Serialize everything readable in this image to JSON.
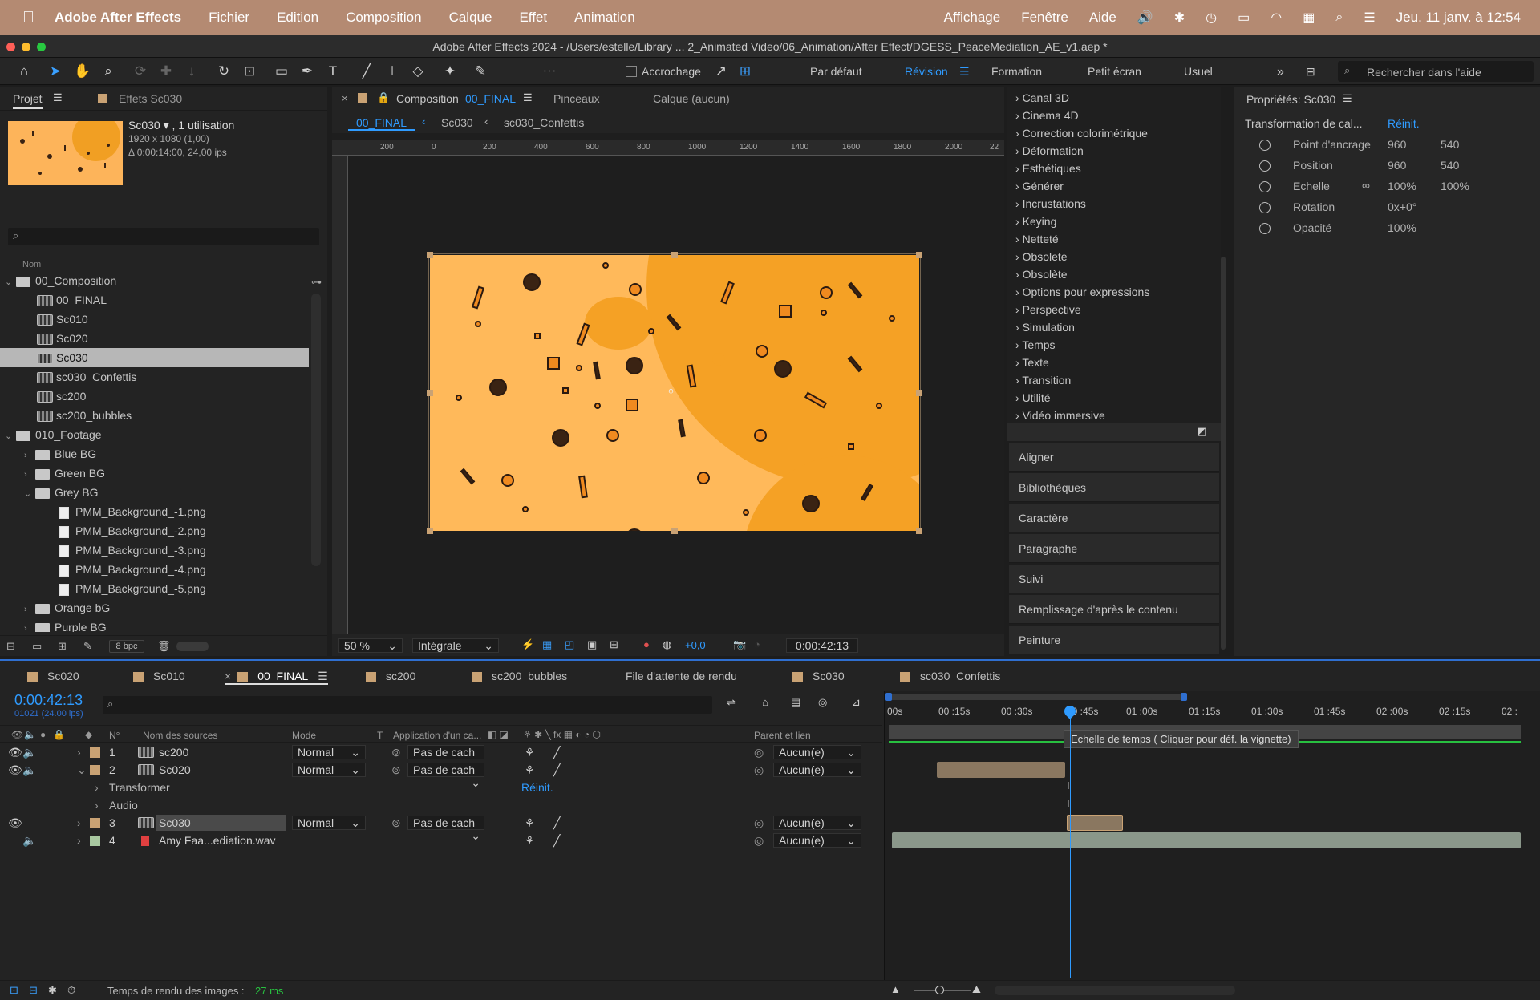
{
  "menubar": {
    "app_name": "Adobe After Effects",
    "items": [
      "Fichier",
      "Edition",
      "Composition",
      "Calque",
      "Effet",
      "Animation"
    ],
    "right_items": [
      "Affichage",
      "Fenêtre",
      "Aide"
    ],
    "clock": "Jeu. 11 janv. à 12:54"
  },
  "window": {
    "title": "Adobe After Effects 2024 - /Users/estelle/Library ... 2_Animated Video/06_Animation/After Effect/DGESS_PeaceMediation_AE_v1.aep *"
  },
  "toolbar": {
    "snap_label": "Accrochage",
    "workspaces": [
      "Par défaut",
      "Révision",
      "Formation",
      "Petit écran",
      "Usuel"
    ],
    "active_workspace": "Révision",
    "help_search_placeholder": "Rechercher dans l'aide"
  },
  "project_panel": {
    "tab_project": "Projet",
    "tab_effects": "Effets Sc030",
    "selected_name": "Sc030 ▾ , 1 utilisation",
    "dimensions": "1920 x 1080 (1,00)",
    "duration": "Δ 0:00:14:00, 24,00 ips",
    "col_name": "Nom",
    "bpc": "8 bpc",
    "items": [
      {
        "label": "00_Composition",
        "type": "folder",
        "indent": 0,
        "expanded": true
      },
      {
        "label": "00_FINAL",
        "type": "comp",
        "indent": 1
      },
      {
        "label": "Sc010",
        "type": "comp",
        "indent": 1
      },
      {
        "label": "Sc020",
        "type": "comp",
        "indent": 1
      },
      {
        "label": "Sc030",
        "type": "comp",
        "indent": 1,
        "selected": true
      },
      {
        "label": "sc030_Confettis",
        "type": "comp",
        "indent": 1
      },
      {
        "label": "sc200",
        "type": "comp",
        "indent": 1
      },
      {
        "label": "sc200_bubbles",
        "type": "comp",
        "indent": 1
      },
      {
        "label": "010_Footage",
        "type": "folder",
        "indent": 0,
        "expanded": true
      },
      {
        "label": "Blue BG",
        "type": "folder",
        "indent": 1,
        "expanded": false
      },
      {
        "label": "Green BG",
        "type": "folder",
        "indent": 1,
        "expanded": false
      },
      {
        "label": "Grey BG",
        "type": "folder",
        "indent": 1,
        "expanded": true
      },
      {
        "label": "PMM_Background_-1.png",
        "type": "file",
        "indent": 2
      },
      {
        "label": "PMM_Background_-2.png",
        "type": "file",
        "indent": 2
      },
      {
        "label": "PMM_Background_-3.png",
        "type": "file",
        "indent": 2
      },
      {
        "label": "PMM_Background_-4.png",
        "type": "file",
        "indent": 2
      },
      {
        "label": "PMM_Background_-5.png",
        "type": "file",
        "indent": 2
      },
      {
        "label": "Orange bG",
        "type": "folder",
        "indent": 1,
        "expanded": false
      },
      {
        "label": "Purple BG",
        "type": "folder",
        "indent": 1,
        "expanded": false
      }
    ]
  },
  "viewer": {
    "tab_composition": "Composition",
    "comp_name": "00_FINAL",
    "tab_brushes": "Pinceaux",
    "tab_layer": "Calque  (aucun)",
    "breadcrumbs": [
      "00_FINAL",
      "Sc030",
      "sc030_Confettis"
    ],
    "ruler_labels": [
      "200",
      "0",
      "200",
      "400",
      "600",
      "800",
      "1000",
      "1200",
      "1400",
      "1600",
      "1800",
      "2000",
      "22"
    ],
    "zoom": "50 %",
    "resolution": "Intégrale",
    "exposure": "+0,0",
    "timecode": "0:00:42:13"
  },
  "effects_list": {
    "items": [
      "Canal 3D",
      "Cinema 4D",
      "Correction colorimétrique",
      "Déformation",
      "Esthétiques",
      "Générer",
      "Incrustations",
      "Keying",
      "Netteté",
      "Obsolete",
      "Obsolète",
      "Options pour expressions",
      "Perspective",
      "Simulation",
      "Temps",
      "Texte",
      "Transition",
      "Utilité",
      "Vidéo immersive"
    ]
  },
  "side_panels": [
    "Aligner",
    "Bibliothèques",
    "Caractère",
    "Paragraphe",
    "Suivi",
    "Remplissage d'après le contenu",
    "Peinture"
  ],
  "properties": {
    "title": "Propriétés: Sc030",
    "section": "Transformation de cal...",
    "reset": "Réinit.",
    "rows": [
      {
        "label": "Point d'ancrage",
        "v1": "960",
        "v2": "540"
      },
      {
        "label": "Position",
        "v1": "960",
        "v2": "540"
      },
      {
        "label": "Echelle",
        "v1": "100%",
        "v2": "100%"
      },
      {
        "label": "Rotation",
        "v1": "0x+0°",
        "v2": ""
      },
      {
        "label": "Opacité",
        "v1": "100%",
        "v2": ""
      }
    ]
  },
  "timeline": {
    "tabs": [
      "Sc020",
      "Sc010",
      "00_FINAL",
      "sc200",
      "sc200_bubbles",
      "File d'attente de rendu",
      "Sc030",
      "sc030_Confettis"
    ],
    "active_tab": "00_FINAL",
    "timecode": "0:00:42:13",
    "frame_info": "01021 (24.00 ips)",
    "columns": {
      "num": "N°",
      "source": "Nom des sources",
      "mode": "Mode",
      "t": "T",
      "matte": "Application d'un ca...",
      "parent": "Parent et lien"
    },
    "ruler": [
      "00s",
      "00 :15s",
      "00 :30s",
      "00 :45s",
      "01 :00s",
      "01 :15s",
      "01 :30s",
      "01 :45s",
      "02 :00s",
      "02 :15s",
      "02 :"
    ],
    "tooltip": "Echelle de temps ( Cliquer pour déf. la vignette)",
    "layers": [
      {
        "num": "1",
        "name": "sc200",
        "mode": "Normal",
        "matte": "Pas de cach",
        "parent": "Aucun(e)",
        "color": "#c9a274"
      },
      {
        "num": "2",
        "name": "Sc020",
        "mode": "Normal",
        "matte": "Pas de cach",
        "parent": "Aucun(e)",
        "color": "#c9a274"
      },
      {
        "num": "3",
        "name": "Sc030",
        "mode": "Normal",
        "matte": "Pas de cach",
        "parent": "Aucun(e)",
        "color": "#c9a274"
      },
      {
        "num": "4",
        "name": "Amy Faa...ediation.wav",
        "mode": "",
        "matte": "",
        "parent": "Aucun(e)",
        "color": "#a8c8a0"
      }
    ],
    "sub_transform": "Transformer",
    "sub_audio": "Audio",
    "sub_reset": "Réinit.",
    "render_time_label": "Temps de rendu des images :",
    "render_time_value": "27 ms"
  },
  "colors": {
    "accent": "#2f9bff",
    "menubar": "#b48a72",
    "canvas_bg": "#ffb95a",
    "canvas_blob": "#f5a125"
  }
}
